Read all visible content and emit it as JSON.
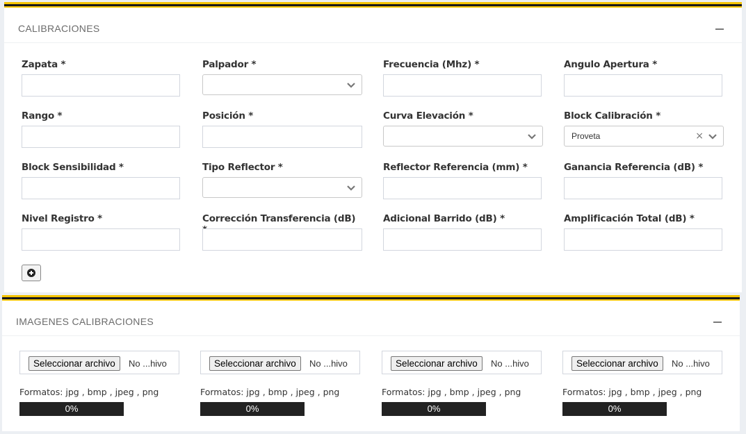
{
  "calibraciones": {
    "title": "CALIBRACIONES",
    "fields": [
      {
        "label": "Zapata *",
        "type": "text",
        "value": ""
      },
      {
        "label": "Palpador *",
        "type": "select",
        "value": ""
      },
      {
        "label": "Frecuencia (Mhz) *",
        "type": "text",
        "value": ""
      },
      {
        "label": "Angulo Apertura *",
        "type": "text",
        "value": ""
      },
      {
        "label": "Rango *",
        "type": "text",
        "value": ""
      },
      {
        "label": "Posición *",
        "type": "text",
        "value": ""
      },
      {
        "label": "Curva Elevación *",
        "type": "select",
        "value": ""
      },
      {
        "label": "Block Calibración *",
        "type": "select",
        "value": "Proveta",
        "clear_icon": "×"
      },
      {
        "label": "Block Sensibilidad *",
        "type": "text",
        "value": ""
      },
      {
        "label": "Tipo Reflector *",
        "type": "select",
        "value": ""
      },
      {
        "label": "Reflector Referencia (mm) *",
        "type": "text",
        "value": ""
      },
      {
        "label": "Ganancia Referencia (dB) *",
        "type": "text",
        "value": ""
      },
      {
        "label": "Nivel Registro *",
        "type": "text",
        "value": ""
      },
      {
        "label": "Corrección Transferencia (dB) *",
        "type": "text",
        "value": ""
      },
      {
        "label": "Adicional Barrido (dB) *",
        "type": "text",
        "value": ""
      },
      {
        "label": "Amplificación Total (dB) *",
        "type": "text",
        "value": ""
      }
    ],
    "add_icon": "plus-circle-icon"
  },
  "imagenes": {
    "title": "IMAGENES CALIBRACIONES",
    "uploads": [
      {
        "button": "Seleccionar archivo",
        "filename": "No ...hivo",
        "formats": "Formatos: jpg , bmp , jpeg , png",
        "progress": "0%"
      },
      {
        "button": "Seleccionar archivo",
        "filename": "No ...hivo",
        "formats": "Formatos: jpg , bmp , jpeg , png",
        "progress": "0%"
      },
      {
        "button": "Seleccionar archivo",
        "filename": "No ...hivo",
        "formats": "Formatos: jpg , bmp , jpeg , png",
        "progress": "0%"
      },
      {
        "button": "Seleccionar archivo",
        "filename": "No ...hivo",
        "formats": "Formatos: jpg , bmp , jpeg , png",
        "progress": "0%"
      }
    ]
  },
  "colors": {
    "accent": "#f5c400",
    "border_dark": "#1a1a1a",
    "progress_bg": "#222222"
  }
}
